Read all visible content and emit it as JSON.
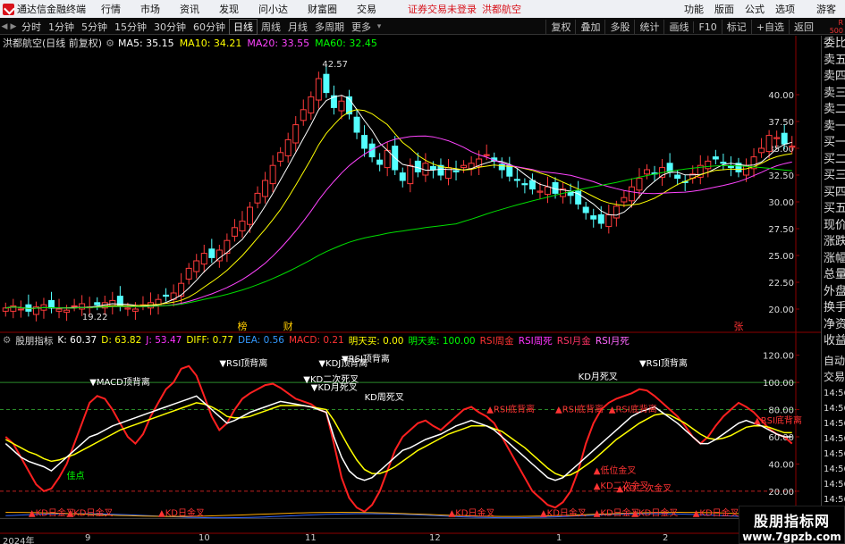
{
  "menubar": {
    "app_title": "通达信金融终端",
    "items": [
      "行情",
      "市场",
      "资讯",
      "发现",
      "问小达",
      "财富圈",
      "交易"
    ],
    "alert": "证券交易未登录",
    "stock_name": "洪都航空",
    "right_items": [
      "功能",
      "版面",
      "公式",
      "选项"
    ],
    "guest": "游客"
  },
  "periodbar": {
    "periods": [
      "分时",
      "1分钟",
      "5分钟",
      "15分钟",
      "30分钟",
      "60分钟",
      "日线",
      "周线",
      "月线",
      "多周期",
      "更多"
    ],
    "active": "日线",
    "tools": [
      "复权",
      "叠加",
      "多股",
      "统计",
      "画线",
      "F10",
      "标记",
      "+自选",
      "返回"
    ],
    "r_tag_top": "R",
    "r_tag_bottom": "500"
  },
  "infoline": {
    "stock_label": "洪都航空(日线 前复权)",
    "ma5": "MA5: 35.15",
    "ma10": "MA10: 34.21",
    "ma20": "MA20: 33.55",
    "ma60": "MA60: 32.45",
    "colors": {
      "ma5": "#ffffff",
      "ma10": "#ffff00",
      "ma20": "#ff44ff",
      "ma60": "#00ff00"
    }
  },
  "price_axis": {
    "ticks": [
      "40.00",
      "37.50",
      "35.00",
      "32.50",
      "30.00",
      "27.50",
      "25.00",
      "22.50",
      "20.00"
    ],
    "values": [
      40,
      37.5,
      35,
      32.5,
      30,
      27.5,
      25,
      22.5,
      20
    ],
    "high_label": "42.57",
    "low_label": "19.22",
    "marks": [
      {
        "text": "榜",
        "color": "#ffcc00"
      },
      {
        "text": "财",
        "color": "#ffcc00"
      },
      {
        "text": "张",
        "color": "#ff3333"
      }
    ]
  },
  "indicator": {
    "name": "股朋指标",
    "k": "K: 60.37",
    "d": "D: 63.82",
    "j": "J: 53.47",
    "diff": "DIFF: 0.77",
    "dea": "DEA: 0.56",
    "macd": "MACD: 0.21",
    "buy_tomorrow": "明天买: 0.00",
    "sell_tomorrow": "明天卖: 100.00",
    "rsi_week_gold": "RSI周金",
    "rsi_week_death": "RSI周死",
    "rsi_month_gold": "RSI月金",
    "rsi_month_death": "RSI月死",
    "ticks": [
      "120.00",
      "100.00",
      "80.00",
      "60.00",
      "40.00",
      "20.00"
    ],
    "tick_values": [
      120,
      100,
      80,
      60,
      40,
      20
    ],
    "annotations": [
      {
        "text": "▼RSI顶背离",
        "color": "#ffffff"
      },
      {
        "text": "▼RSI顶背离",
        "color": "#ffffff"
      },
      {
        "text": "▼KDJ顶背离",
        "color": "#ffffff"
      },
      {
        "text": "▼RSI顶背离",
        "color": "#ffffff"
      },
      {
        "text": "▼MACD顶背离",
        "color": "#ffffff"
      },
      {
        "text": "▼KD二次死叉",
        "color": "#ffffff"
      },
      {
        "text": "▼KD月死叉",
        "color": "#ffffff"
      },
      {
        "text": "KD周死叉",
        "color": "#ffffff"
      },
      {
        "text": "KD月死叉",
        "color": "#ffffff"
      },
      {
        "text": "▲RSI底背离",
        "color": "#ff3333"
      },
      {
        "text": "▲RSI底背离",
        "color": "#ff3333"
      },
      {
        "text": "▲RSI底背离",
        "color": "#ff3333"
      },
      {
        "text": "▲RSI底背离",
        "color": "#ff3333"
      },
      {
        "text": "▲低位金叉",
        "color": "#ff3333"
      },
      {
        "text": "▲KD二次金叉",
        "color": "#ff3333"
      },
      {
        "text": "▲KD二次金叉",
        "color": "#ff3333"
      },
      {
        "text": "▲KD日金叉",
        "color": "#ff3333"
      },
      {
        "text": "▲KD日金叉",
        "color": "#ff3333"
      },
      {
        "text": "▲KD日金叉",
        "color": "#ff3333"
      },
      {
        "text": "▲KD日金叉",
        "color": "#ff3333"
      },
      {
        "text": "▲KD日金叉",
        "color": "#ff3333"
      },
      {
        "text": "▲KD日金叉",
        "color": "#ff3333"
      },
      {
        "text": "▲KD日金叉",
        "color": "#ff3333"
      },
      {
        "text": "▲KD日金叉",
        "color": "#ff3333"
      },
      {
        "text": "佳点",
        "color": "#00ff00"
      }
    ]
  },
  "rightpanel": {
    "items": [
      "委比",
      "卖五",
      "卖四",
      "卖三",
      "卖二",
      "卖一",
      "买一",
      "买二",
      "买三",
      "买四",
      "买五",
      "现价",
      "涨跌",
      "涨幅",
      "总量",
      "外盘",
      "换手",
      "净资",
      "收益"
    ],
    "auto": "自动",
    "trade": "交易",
    "times": [
      "14:56",
      "14:56",
      "14:56",
      "14:56",
      "14:56",
      "14:56",
      "14:56",
      "14:56"
    ]
  },
  "dateaxis": {
    "labels": [
      "2024年",
      "9",
      "10",
      "11",
      "12",
      "1",
      "2"
    ]
  },
  "watermark": {
    "title": "股朋指标网",
    "url": "www.7gpzb.com"
  },
  "chart_data": {
    "type": "candlestick",
    "ylim": [
      18,
      44
    ],
    "close": [
      20.1,
      20.3,
      20.0,
      19.8,
      20.2,
      20.4,
      20.1,
      20.0,
      19.9,
      20.3,
      20.5,
      20.2,
      20.4,
      20.6,
      20.8,
      20.3,
      20.1,
      20.0,
      20.4,
      20.6,
      20.9,
      21.2,
      21.5,
      22.4,
      23.8,
      24.5,
      25.2,
      24.8,
      25.5,
      26.4,
      27.6,
      28.2,
      29.5,
      30.8,
      32.0,
      33.4,
      34.6,
      35.8,
      37.2,
      38.6,
      39.8,
      41.5,
      40.2,
      38.8,
      39.4,
      38.2,
      36.5,
      35.0,
      34.2,
      33.5,
      34.8,
      33.0,
      32.0,
      33.4,
      32.8,
      33.6,
      33.0,
      32.5,
      33.2,
      32.8,
      33.4,
      33.6,
      34.0,
      34.4,
      33.8,
      33.0,
      32.4,
      32.0,
      31.6,
      31.2,
      31.0,
      31.4,
      30.8,
      31.2,
      30.6,
      29.8,
      29.0,
      28.4,
      28.0,
      28.8,
      29.6,
      30.4,
      31.4,
      32.2,
      33.0,
      32.6,
      33.2,
      32.8,
      32.2,
      31.8,
      32.6,
      33.4,
      33.8,
      34.0,
      33.6,
      33.2,
      32.8,
      33.4,
      34.2,
      35.0,
      36.2,
      36.0,
      35.4,
      35.2
    ],
    "kdj_k": [
      55,
      50,
      45,
      42,
      40,
      38,
      35,
      40,
      45,
      50,
      55,
      60,
      62,
      65,
      68,
      70,
      72,
      74,
      76,
      78,
      80,
      82,
      84,
      86,
      88,
      90,
      85,
      80,
      75,
      70,
      72,
      75,
      78,
      80,
      82,
      84,
      86,
      85,
      84,
      83,
      82,
      80,
      78,
      60,
      45,
      35,
      30,
      28,
      30,
      35,
      40,
      45,
      50,
      52,
      55,
      58,
      60,
      62,
      65,
      68,
      70,
      72,
      70,
      68,
      65,
      60,
      55,
      50,
      45,
      40,
      35,
      30,
      28,
      30,
      35,
      40,
      45,
      50,
      55,
      60,
      65,
      70,
      75,
      78,
      80,
      82,
      78,
      74,
      70,
      65,
      60,
      55,
      55,
      58,
      62,
      66,
      70,
      72,
      70,
      68,
      65,
      62,
      60,
      60
    ],
    "kdj_d": [
      58,
      55,
      52,
      49,
      47,
      44,
      42,
      43,
      45,
      47,
      50,
      53,
      56,
      59,
      62,
      65,
      67,
      69,
      71,
      73,
      75,
      77,
      79,
      81,
      83,
      85,
      84,
      82,
      79,
      75,
      74,
      74,
      75,
      77,
      79,
      81,
      83,
      83,
      83,
      83,
      82,
      81,
      80,
      72,
      62,
      52,
      43,
      36,
      33,
      33,
      35,
      38,
      42,
      46,
      50,
      53,
      56,
      59,
      62,
      64,
      66,
      68,
      68,
      68,
      66,
      64,
      60,
      56,
      52,
      47,
      42,
      37,
      33,
      31,
      32,
      35,
      39,
      43,
      48,
      53,
      58,
      62,
      66,
      70,
      73,
      76,
      77,
      76,
      73,
      70,
      66,
      62,
      59,
      58,
      59,
      61,
      64,
      67,
      68,
      68,
      67,
      65,
      63,
      63
    ],
    "rsi": [
      60,
      55,
      45,
      35,
      25,
      20,
      22,
      30,
      40,
      55,
      70,
      85,
      90,
      88,
      80,
      70,
      60,
      55,
      62,
      75,
      85,
      95,
      100,
      110,
      112,
      105,
      90,
      75,
      65,
      70,
      80,
      88,
      92,
      95,
      98,
      99,
      96,
      92,
      88,
      86,
      84,
      80,
      78,
      55,
      30,
      15,
      8,
      5,
      10,
      20,
      35,
      50,
      60,
      65,
      70,
      72,
      68,
      65,
      70,
      75,
      80,
      82,
      78,
      75,
      70,
      60,
      50,
      40,
      30,
      20,
      15,
      10,
      8,
      12,
      20,
      35,
      55,
      70,
      80,
      85,
      88,
      90,
      92,
      95,
      94,
      90,
      85,
      80,
      75,
      68,
      60,
      55,
      60,
      68,
      75,
      80,
      85,
      82,
      78,
      72,
      66,
      62,
      60,
      55
    ]
  }
}
